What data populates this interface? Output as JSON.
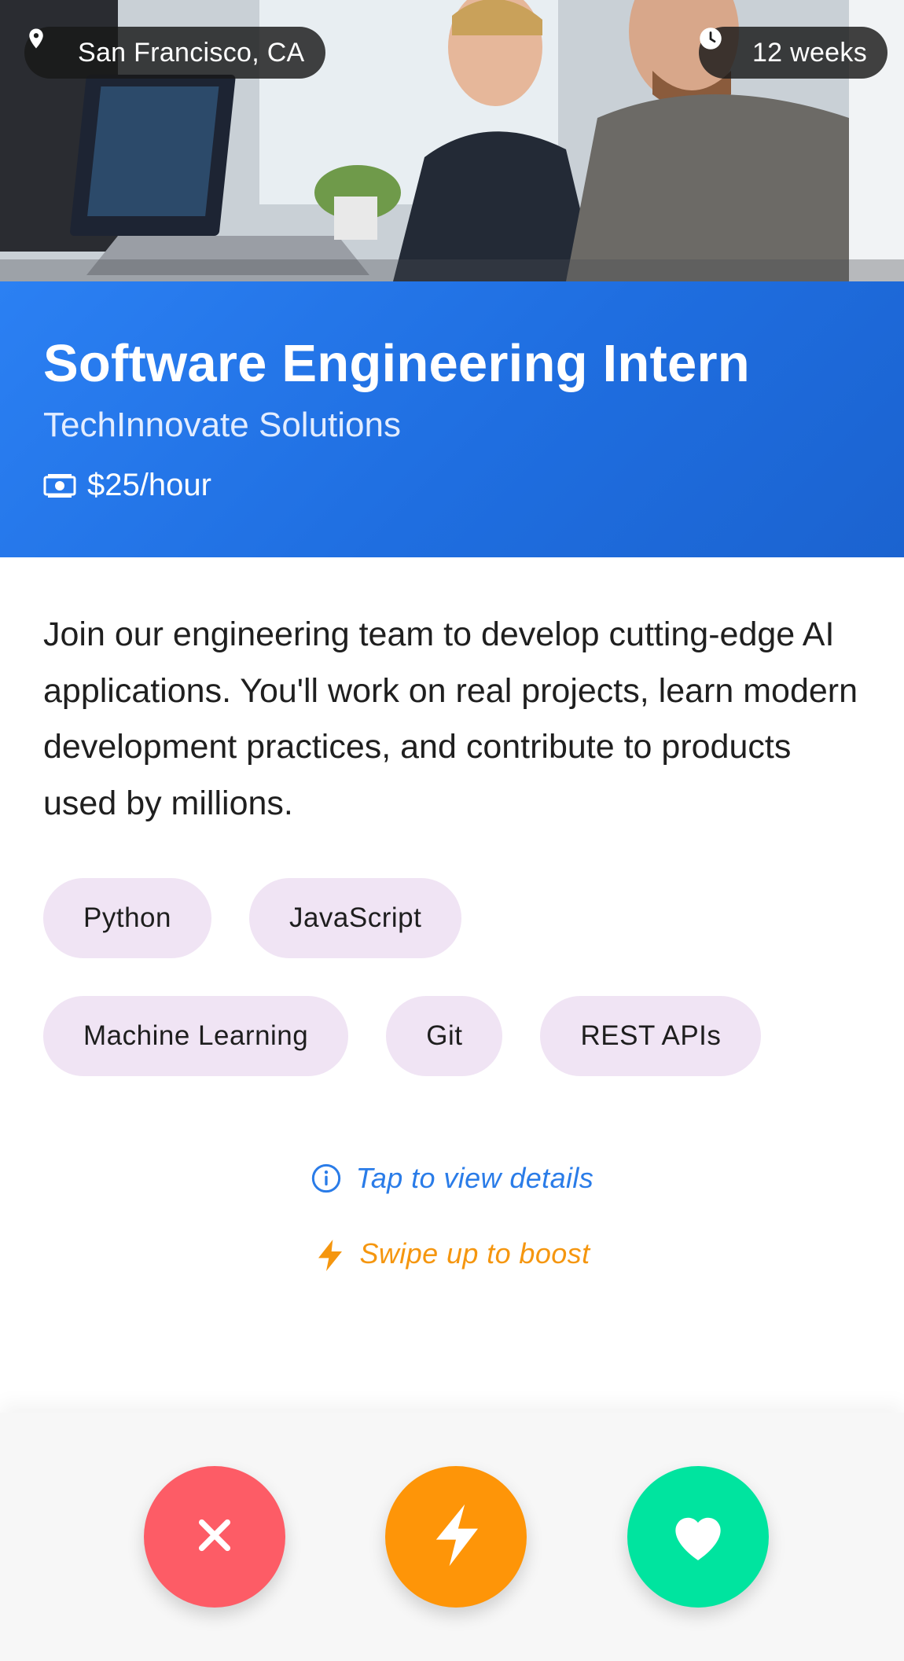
{
  "job": {
    "location": "San Francisco, CA",
    "duration": "12 weeks",
    "title": "Software Engineering Intern",
    "company": "TechInnovate Solutions",
    "pay": "$25/hour",
    "description": "Join our engineering team to develop cutting-edge AI applications. You'll work on real projects, learn modern development practices, and contribute to products used by millions."
  },
  "skills": [
    [
      "Python",
      "JavaScript"
    ],
    [
      "Machine Learning",
      "Git",
      "REST APIs"
    ]
  ],
  "hints": {
    "details": "Tap to view details",
    "boost": "Swipe up to boost"
  },
  "actions": {
    "pass_icon": "close-icon",
    "boost_icon": "lightning-icon",
    "like_icon": "heart-icon"
  },
  "colors": {
    "header_blue": "#2b80f3",
    "pass_red": "#fd5c66",
    "boost_orange": "#fe9508",
    "like_green": "#00e49f",
    "skill_chip": "#f0e4f4",
    "details_link": "#2a7ce8",
    "boost_hint": "#f5960f"
  }
}
